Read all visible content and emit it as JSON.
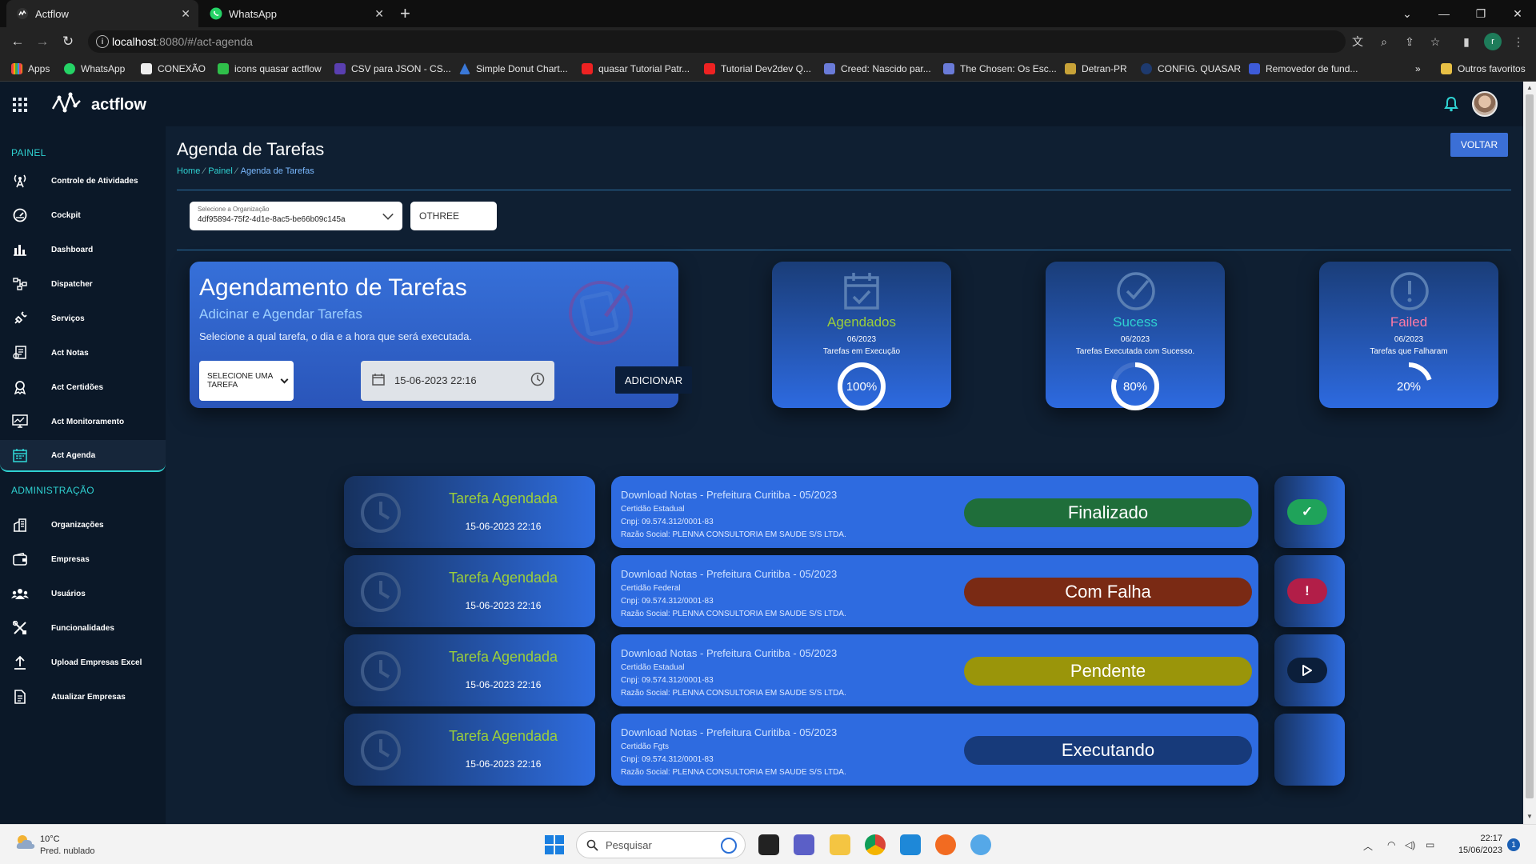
{
  "browser": {
    "tabs": [
      {
        "title": "Actflow",
        "active": true
      },
      {
        "title": "WhatsApp",
        "active": false
      }
    ],
    "url_host": "localhost",
    "url_path": ":8080/#/act-agenda",
    "profile_initial": "r",
    "bookmarks": [
      "Apps",
      "WhatsApp",
      "CONEXÃO",
      "icons quasar actflow",
      "CSV para JSON - CS...",
      "Simple Donut Chart...",
      "quasar Tutorial Patr...",
      "Tutorial Dev2dev Q...",
      "Creed: Nascido par...",
      "The Chosen: Os Esc...",
      "Detran-PR",
      "CONFIG. QUASAR",
      "Removedor de fund..."
    ],
    "bookmarks_more": "»",
    "other_favorites": "Outros favoritos"
  },
  "app": {
    "brand": "actflow",
    "accent_color": "#2fd1d1",
    "sidebar": {
      "section_panel": "PAINEL",
      "panel_items": [
        {
          "label": "Controle de Atividades",
          "icon": "antenna-icon"
        },
        {
          "label": "Cockpit",
          "icon": "gauge-icon"
        },
        {
          "label": "Dashboard",
          "icon": "bar-chart-icon"
        },
        {
          "label": "Dispatcher",
          "icon": "flow-icon"
        },
        {
          "label": "Serviços",
          "icon": "plug-icon"
        },
        {
          "label": "Act Notas",
          "icon": "notes-icon"
        },
        {
          "label": "Act Certidões",
          "icon": "award-icon"
        },
        {
          "label": "Act Monitoramento",
          "icon": "monitor-icon"
        },
        {
          "label": "Act Agenda",
          "icon": "calendar-icon",
          "active": true
        }
      ],
      "section_admin": "ADMINISTRAÇÃO",
      "admin_items": [
        {
          "label": "Organizações",
          "icon": "building-icon"
        },
        {
          "label": "Empresas",
          "icon": "wallet-icon"
        },
        {
          "label": "Usuários",
          "icon": "users-icon"
        },
        {
          "label": "Funcionalidades",
          "icon": "tools-icon"
        },
        {
          "label": "Upload Empresas Excel",
          "icon": "upload-icon"
        },
        {
          "label": "Atualizar Empresas",
          "icon": "document-icon"
        }
      ]
    },
    "page": {
      "title": "Agenda de Tarefas",
      "breadcrumb": [
        "Home",
        "Painel",
        "Agenda de Tarefas"
      ],
      "back_button": "VOLTAR",
      "org_select": {
        "label": "Selecione a Organização",
        "value": "4df95894-75f2-4d1e-8ac5-be66b09c145a"
      },
      "org_name": "OTHREE"
    },
    "scheduler": {
      "title": "Agendamento de Tarefas",
      "subtitle": "Adicinar e Agendar Tarefas",
      "description": "Selecione a qual tarefa, o dia e a hora que será executada.",
      "task_select": "SELECIONE UMA TAREFA",
      "datetime": "15-06-2023 22:16",
      "add_button": "ADICIONAR"
    },
    "stats": [
      {
        "title": "Agendados",
        "period": "06/2023",
        "desc": "Tarefas em Execução",
        "percent": 100,
        "label": "100%",
        "color": "#9ccf3a",
        "icon": "calendar-check-icon"
      },
      {
        "title": "Sucess",
        "period": "06/2023",
        "desc": "Tarefas Executada com Sucesso.",
        "percent": 80,
        "label": "80%",
        "color": "#2fd1d1",
        "icon": "check-circle-icon"
      },
      {
        "title": "Failed",
        "period": "06/2023",
        "desc": "Tarefas que Falharam",
        "percent": 20,
        "label": "20%",
        "color": "#ff7aa6",
        "icon": "alert-circle-icon"
      }
    ],
    "tasks": [
      {
        "card_title": "Tarefa Agendada",
        "date": "15-06-2023 22:16",
        "name": "Download Notas - Prefeitura Curitiba - 05/2023",
        "type": "Certidão Estadual",
        "cnpj": "Cnpj: 09.574.312/0001-83",
        "razao": "Razão Social: PLENNA CONSULTORIA EM SAUDE S/S LTDA.",
        "status": "Finalizado",
        "status_color": "#1f6e3a",
        "action": "check-icon",
        "action_color": "#1fa35a"
      },
      {
        "card_title": "Tarefa Agendada",
        "date": "15-06-2023 22:16",
        "name": "Download Notas - Prefeitura Curitiba - 05/2023",
        "type": "Certidão Federal",
        "cnpj": "Cnpj: 09.574.312/0001-83",
        "razao": "Razão Social: PLENNA CONSULTORIA EM SAUDE S/S LTDA.",
        "status": "Com Falha",
        "status_color": "#7a2a14",
        "action": "exclamation-icon",
        "action_color": "#b21e48"
      },
      {
        "card_title": "Tarefa Agendada",
        "date": "15-06-2023 22:16",
        "name": "Download Notas - Prefeitura Curitiba - 05/2023",
        "type": "Certidão Estadual",
        "cnpj": "Cnpj: 09.574.312/0001-83",
        "razao": "Razão Social: PLENNA CONSULTORIA EM SAUDE S/S LTDA.",
        "status": "Pendente",
        "status_color": "#9a950a",
        "action": "play-icon",
        "action_color": "#0b1e3a"
      },
      {
        "card_title": "Tarefa Agendada",
        "date": "15-06-2023 22:16",
        "name": "Download Notas - Prefeitura Curitiba - 05/2023",
        "type": "Certidão Fgts",
        "cnpj": "Cnpj: 09.574.312/0001-83",
        "razao": "Razão Social: PLENNA CONSULTORIA EM SAUDE S/S LTDA.",
        "status": "Executando",
        "status_color": "#173a7a",
        "action": "",
        "action_color": ""
      }
    ]
  },
  "taskbar": {
    "temp": "10°C",
    "weather": "Pred. nublado",
    "search_placeholder": "Pesquisar",
    "time": "22:17",
    "date": "15/06/2023",
    "notifications": "1"
  }
}
